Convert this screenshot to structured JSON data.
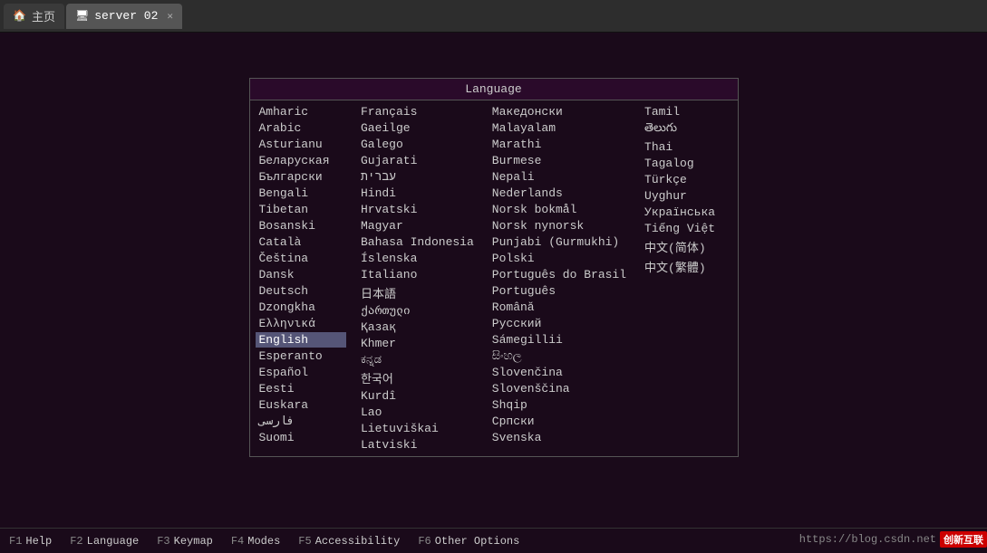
{
  "tabs": [
    {
      "label": "主页",
      "icon": "🏠",
      "active": false,
      "closable": false
    },
    {
      "label": "server 02",
      "icon": "🖥",
      "active": true,
      "closable": true
    }
  ],
  "dialog": {
    "title": "Language",
    "columns": [
      [
        "Amharic",
        "Arabic",
        "Asturianu",
        "Беларуская",
        "Български",
        "Bengali",
        "Tibetan",
        "Bosanski",
        "Català",
        "Čeština",
        "Dansk",
        "Deutsch",
        "Dzongkha",
        "Ελληνικά",
        "English",
        "Esperanto",
        "Español",
        "Eesti",
        "Euskara",
        "فارسی",
        "Suomi"
      ],
      [
        "Français",
        "Gaeilge",
        "Galego",
        "Gujarati",
        "עברית",
        "Hindi",
        "Hrvatski",
        "Magyar",
        "Bahasa Indonesia",
        "Íslenska",
        "Italiano",
        "日本語",
        "ქართული",
        "Қазақ",
        "Khmer",
        "ಕನ್ನಡ",
        "한국어",
        "Kurdî",
        "Lao",
        "Lietuviškai",
        "Latviski"
      ],
      [
        "Македонски",
        "Malayalam",
        "Marathi",
        "Burmese",
        "Nepali",
        "Nederlands",
        "Norsk bokmål",
        "Norsk nynorsk",
        "Punjabi (Gurmukhi)",
        "Polski",
        "Português do Brasil",
        "Português",
        "Română",
        "Русский",
        "Sámegillii",
        "සිංහල",
        "Slovenčina",
        "Slovenščina",
        "Shqip",
        "Српски",
        "Svenska"
      ],
      [
        "Tamil",
        "తెలుగు",
        "Thai",
        "Tagalog",
        "Türkçe",
        "Uyghur",
        "Українська",
        "Tiếng Việt",
        "中文(简体)",
        "中文(繁體)"
      ]
    ],
    "selected": "English"
  },
  "funcbar": [
    {
      "key": "F1",
      "label": "Help"
    },
    {
      "key": "F2",
      "label": "Language"
    },
    {
      "key": "F3",
      "label": "Keymap"
    },
    {
      "key": "F4",
      "label": "Modes"
    },
    {
      "key": "F5",
      "label": "Accessibility"
    },
    {
      "key": "F6",
      "label": "Other Options"
    }
  ],
  "watermark": {
    "url": "https://blog.csdn.net",
    "logo": "创新互联"
  }
}
